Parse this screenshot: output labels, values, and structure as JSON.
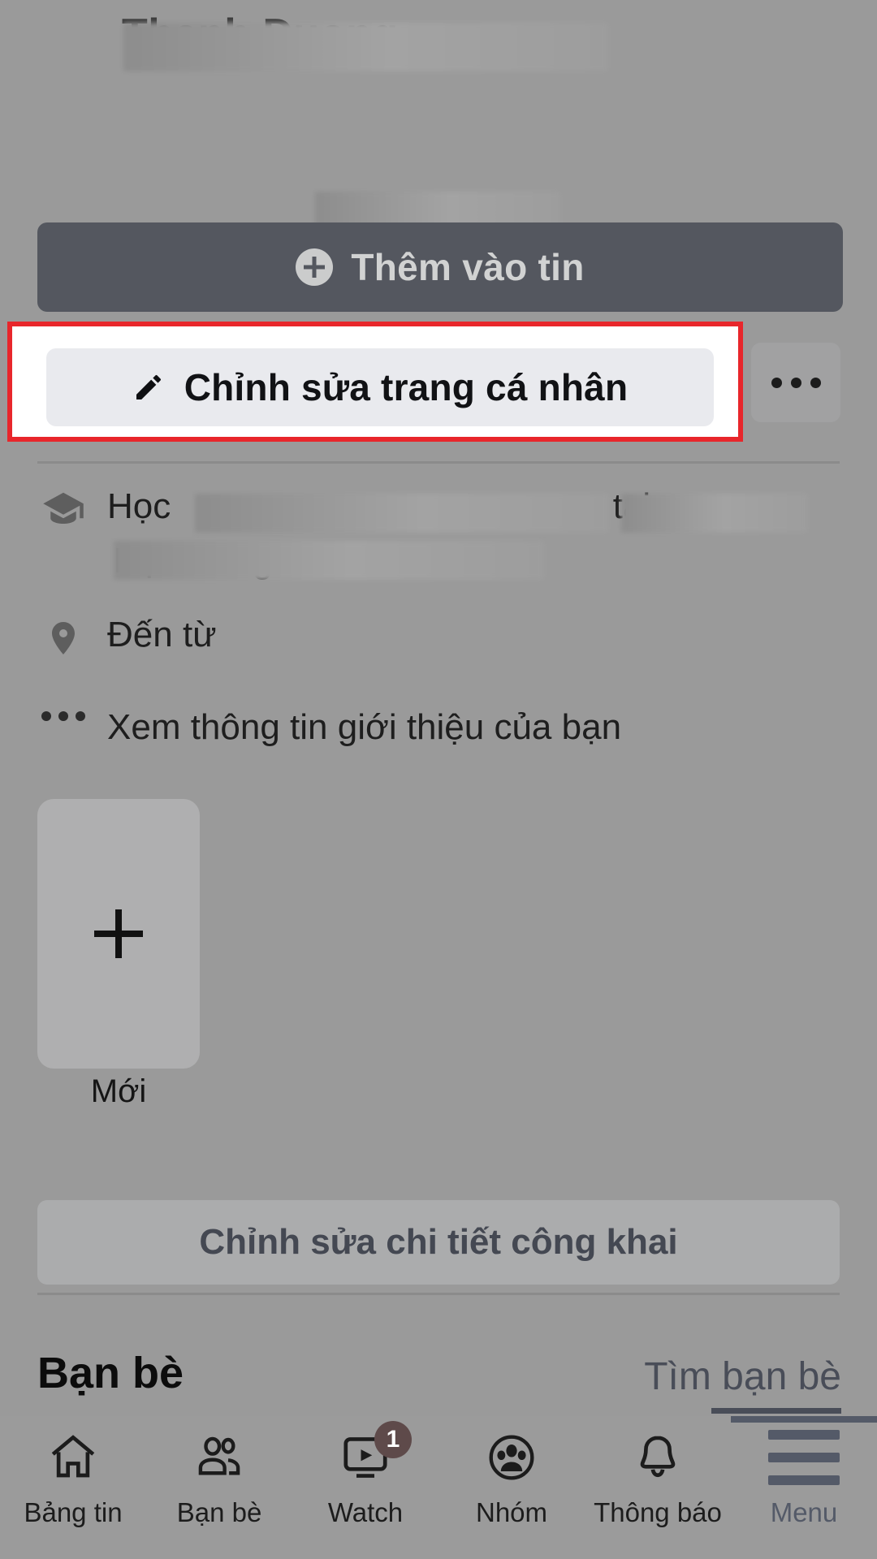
{
  "profile": {
    "name_redacted": "Thanh Duong",
    "bio_redacted": "Keep it simple",
    "name_is_blurred": true,
    "bio_is_blurred": true
  },
  "actions": {
    "add_story_label": "Thêm vào tin",
    "add_story_icon": "plus-circle-icon",
    "edit_profile_label": "Chỉnh sửa trang cá nhân",
    "edit_profile_icon": "pencil-icon",
    "more_label": "...",
    "more_icon": "ellipsis-icon"
  },
  "highlight": {
    "color": "#e8262b",
    "target": "edit-profile-button"
  },
  "info_rows": [
    {
      "icon": "graduation-cap-icon",
      "prefix": "Học",
      "middle": "tại",
      "line2_redacted": "Học Nông Lâm TP HCM",
      "redacted": true
    },
    {
      "icon": "location-pin-icon",
      "label": "Đến từ",
      "redacted": false
    },
    {
      "icon": "ellipsis-icon",
      "label": "Xem thông tin giới thiệu của bạn",
      "redacted": false
    }
  ],
  "story": {
    "add_icon": "plus-icon",
    "label": "Mới"
  },
  "public_details": {
    "label": "Chỉnh sửa chi tiết công khai",
    "color": "#29489c"
  },
  "friends": {
    "title": "Bạn bè",
    "find_link": "Tìm bạn bè"
  },
  "tabbar": {
    "items": [
      {
        "icon": "home-icon",
        "label": "Bảng tin",
        "active": false,
        "badge": null
      },
      {
        "icon": "friends-icon",
        "label": "Bạn bè",
        "active": false,
        "badge": null
      },
      {
        "icon": "watch-icon",
        "label": "Watch",
        "active": false,
        "badge": "1"
      },
      {
        "icon": "groups-icon",
        "label": "Nhóm",
        "active": false,
        "badge": null
      },
      {
        "icon": "bell-icon",
        "label": "Thông báo",
        "active": false,
        "badge": null
      },
      {
        "icon": "hamburger-menu-icon",
        "label": "Menu",
        "active": true,
        "badge": null
      }
    ],
    "active_color": "#2d5bd0"
  },
  "colors": {
    "page_bg": "#9a9a9a",
    "primary_blue": "#3b5998",
    "link_blue": "#2d4da7",
    "highlight_red": "#e8262b",
    "button_gray": "#e9eaee"
  }
}
